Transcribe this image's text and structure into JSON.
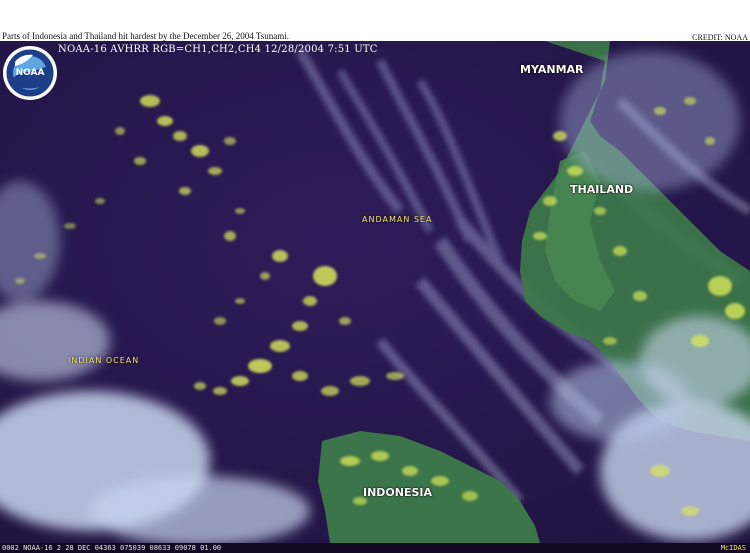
{
  "caption": "Parts of Indonesia and Thailand hit hardest by the December 26, 2004 Tsunami.",
  "credit": "CREDIT: NOAA",
  "satellite_header": "NOAA-16 AVHRR  RGB=CH1,CH2,CH4  12/28/2004  7:51 UTC",
  "logo": {
    "name": "NOAA",
    "ring_text": "NATIONAL OCEANIC AND ATMOSPHERIC ADMINISTRATION · U.S. DEPARTMENT OF COMMERCE"
  },
  "labels": {
    "myanmar": "MYANMAR",
    "thailand": "THAILAND",
    "andaman_sea": "ANDAMAN SEA",
    "indian_ocean": "INDIAN OCEAN",
    "indonesia": "INDONESIA"
  },
  "mcidas": {
    "line": "0002 NOAA-16    2 28 DEC 04363 075039 08633 09078 01.00",
    "tag": "McIDAS"
  },
  "colors": {
    "ocean": "#2a1a52",
    "land": "#3f7a4c",
    "cloud": "#c8d8f0",
    "cumulus": "#d9e85a"
  }
}
